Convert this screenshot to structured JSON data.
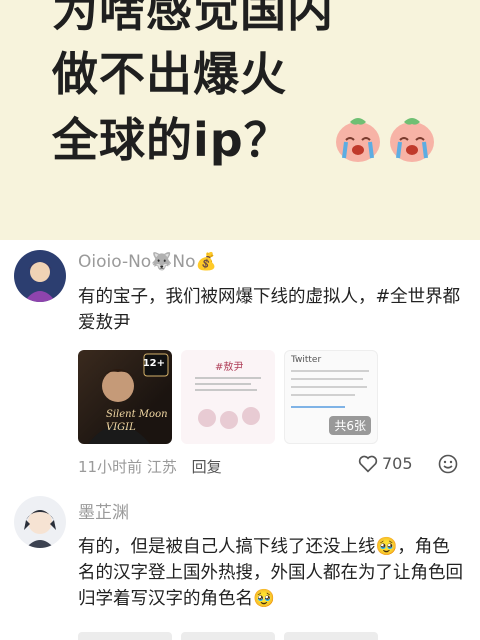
{
  "banner": {
    "line1": "为啥感觉国内",
    "line2": "做不出爆火",
    "line3": "全球的ip？"
  },
  "comments": [
    {
      "username": "Oioio-No🐺No💰",
      "text": "有的宝子，我们被网爆下线的虚拟人，#全世界都爱敖尹",
      "images": [
        {
          "badge": "12+",
          "caption": "Silent Moon VIGIL"
        },
        {
          "caption": "#敖尹"
        },
        {
          "caption": "Twitter"
        }
      ],
      "image_count": "共6张",
      "time": "11小时前",
      "location": "江苏",
      "reply_label": "回复",
      "likes": "705"
    },
    {
      "username": "墨芷渊",
      "text": "有的，但是被自己人搞下线了还没上线🥹，角色名的汉字登上国外热搜，外国人都在为了让角色回归学着写汉字的角色名🥹"
    }
  ],
  "colors": {
    "banner_bg": "#f7f3dc",
    "meta_text": "#9a9a9a"
  }
}
